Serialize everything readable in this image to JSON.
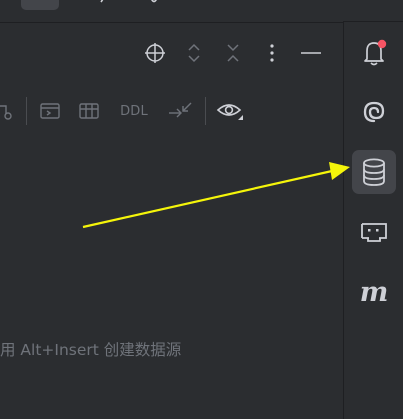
{
  "toolbar": {
    "ddl_label": "DDL"
  },
  "empty_state": {
    "hint_text": "用 Alt+Insert 创建数据源"
  },
  "side_strip": {
    "items": [
      {
        "icon": "notifications-bell-icon",
        "badge": true
      },
      {
        "icon": "ai-assistant-spiral-icon"
      },
      {
        "icon": "database-icon",
        "active": true
      },
      {
        "icon": "remote-terminal-icon"
      },
      {
        "icon": "maven-m-icon",
        "label": "m"
      }
    ]
  },
  "annotation": {
    "arrow_color": "#f5f50a"
  },
  "colors": {
    "background": "#2b2d30",
    "icon": "#ced0d6",
    "icon_dim": "#6f737a",
    "active_bg": "#43454a",
    "badge": "#f75464"
  }
}
